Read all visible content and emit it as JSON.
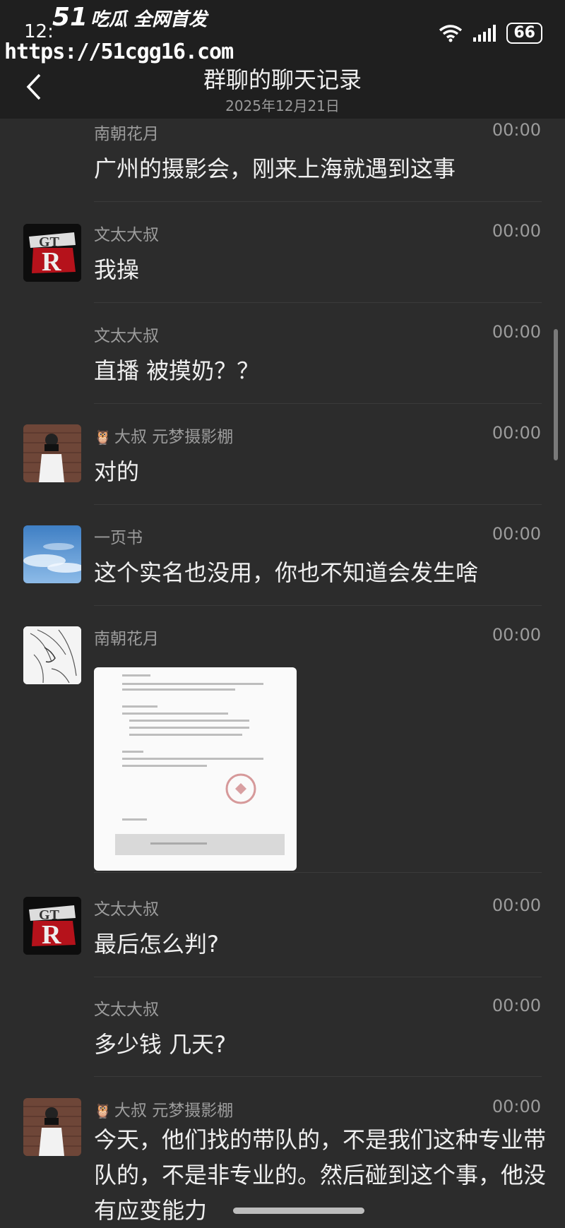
{
  "status": {
    "time": "12:",
    "battery": "66"
  },
  "watermark": {
    "logo": "51",
    "slogan": "吃瓜 全网首发",
    "url": "https://51cgg16.com"
  },
  "header": {
    "title": "群聊的聊天记录",
    "date": "2025年12月21日"
  },
  "messages": [
    {
      "sender": "南朝花月",
      "time": "00:00",
      "text": "广州的摄影会，刚来上海就遇到这事"
    },
    {
      "sender": "文太大叔",
      "time": "00:00",
      "text": "我操"
    },
    {
      "sender": "文太大叔",
      "time": "00:00",
      "text": "直播 被摸奶？？"
    },
    {
      "sender": "大叔 元梦摄影棚",
      "time": "00:00",
      "text": "对的"
    },
    {
      "sender": "一页书",
      "time": "00:00",
      "text": "这个实名也没用，你也不知道会发生啥"
    },
    {
      "sender": "南朝花月",
      "time": "00:00",
      "text": ""
    },
    {
      "sender": "文太大叔",
      "time": "00:00",
      "text": "最后怎么判?"
    },
    {
      "sender": "文太大叔",
      "time": "00:00",
      "text": "多少钱 几天?"
    },
    {
      "sender": "大叔 元梦摄影棚",
      "time": "00:00",
      "text": "今天，他们找的带队的，不是我们这种专业带队的，不是非专业的。然后碰到这个事，他没有应变能力"
    }
  ],
  "colors": {
    "background": "#2c2c2c",
    "header": "#1f1f1f",
    "text": "#efefef",
    "meta": "#9c9c9c"
  },
  "icons": {
    "back": "chevron-left-icon",
    "wifi": "wifi-icon",
    "signal": "signal-icon",
    "owl": "owl-icon"
  }
}
